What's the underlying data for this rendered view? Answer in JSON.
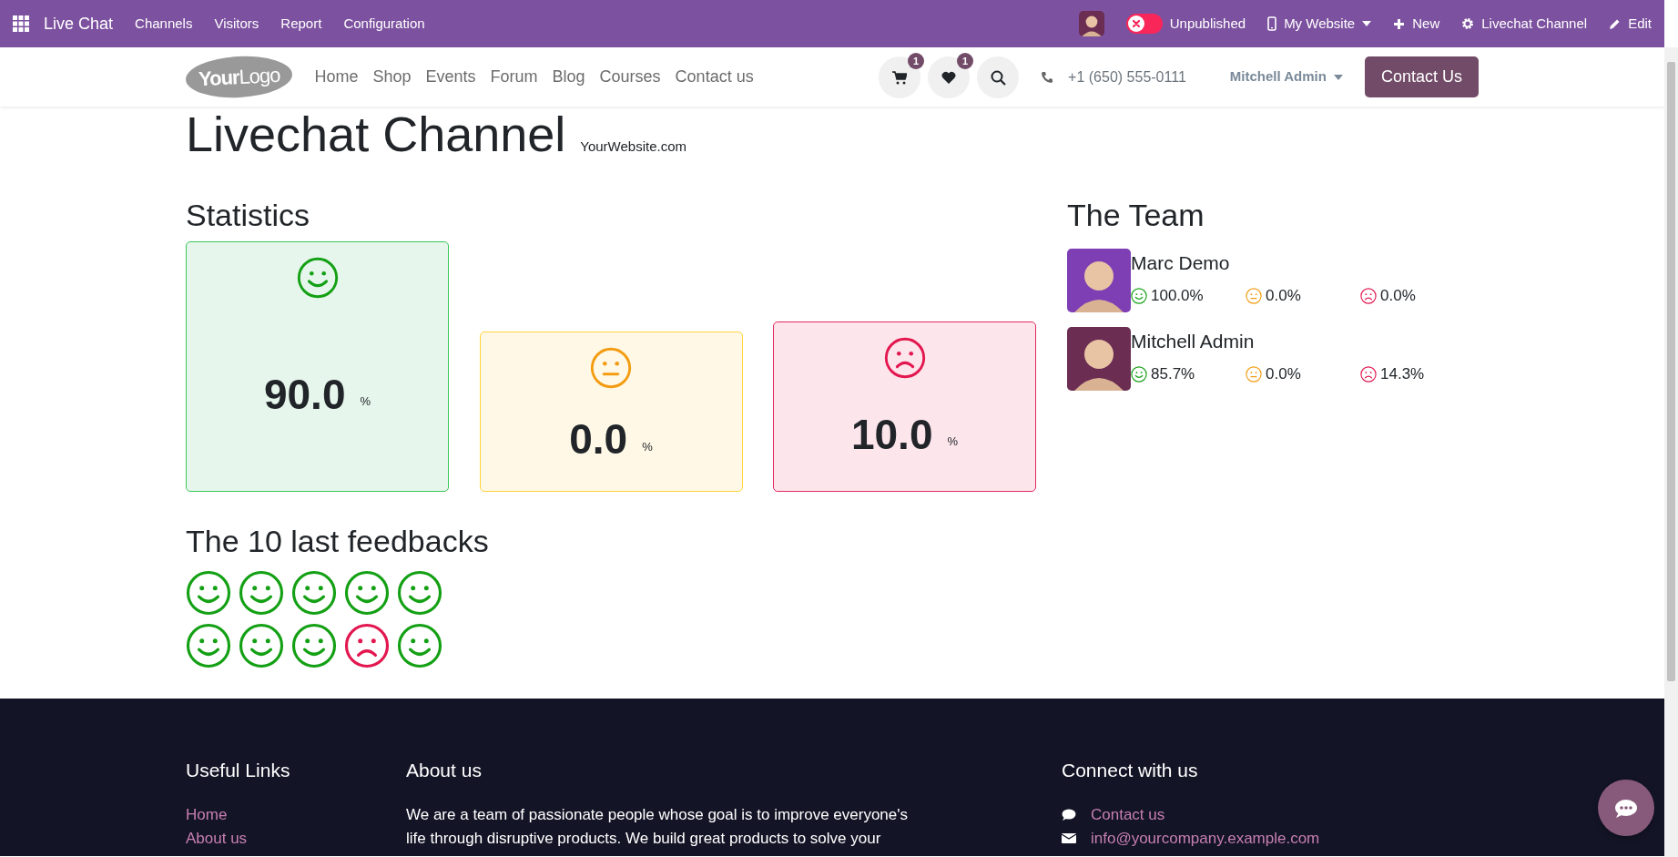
{
  "top_bar": {
    "app_title": "Live Chat",
    "menu": [
      "Channels",
      "Visitors",
      "Report",
      "Configuration"
    ],
    "publish": {
      "label": "Unpublished",
      "published": false
    },
    "items": [
      {
        "kind": "device",
        "label": "My Website"
      },
      {
        "kind": "new",
        "label": "New"
      },
      {
        "kind": "settings",
        "label": "Livechat Channel"
      },
      {
        "kind": "edit",
        "label": "Edit"
      }
    ]
  },
  "navbar": {
    "logo": "**Your**Logo",
    "links": [
      "Home",
      "Shop",
      "Events",
      "Forum",
      "Blog",
      "Courses",
      "Contact us"
    ],
    "cart_count": "1",
    "wishlist_count": "1",
    "phone": "+1 (650) 555-0111",
    "user": "Mitchell Admin",
    "cta": "Contact Us"
  },
  "page": {
    "title": "Livechat Channel",
    "subtitle": "YourWebsite.com"
  },
  "statistics": {
    "heading": "Statistics",
    "cards": [
      {
        "kind": "happy",
        "value": "90.0",
        "unit": "%"
      },
      {
        "kind": "neutral",
        "value": "0.0",
        "unit": "%"
      },
      {
        "kind": "sad",
        "value": "10.0",
        "unit": "%"
      }
    ]
  },
  "team": {
    "heading": "The Team",
    "members": [
      {
        "name": "Marc Demo",
        "happy": "100.0%",
        "neutral": "0.0%",
        "sad": "0.0%"
      },
      {
        "name": "Mitchell Admin",
        "happy": "85.7%",
        "neutral": "0.0%",
        "sad": "14.3%"
      }
    ]
  },
  "feedbacks": {
    "heading": "The 10 last feedbacks",
    "items": [
      {
        "kind": "happy"
      },
      {
        "kind": "happy"
      },
      {
        "kind": "happy"
      },
      {
        "kind": "happy"
      },
      {
        "kind": "happy"
      },
      {
        "kind": "happy"
      },
      {
        "kind": "happy"
      },
      {
        "kind": "happy"
      },
      {
        "kind": "sad"
      },
      {
        "kind": "happy"
      }
    ]
  },
  "footer": {
    "columns": [
      {
        "kind": "links",
        "heading": "Useful Links",
        "items": [
          "Home",
          "About us"
        ]
      },
      {
        "kind": "text",
        "heading": "About us",
        "text": "We are a team of passionate people whose goal is to improve everyone's life through disruptive products. We build great products to solve your"
      },
      {
        "kind": "contact",
        "heading": "Connect with us",
        "items": [
          {
            "kind": "chat",
            "label": "Contact us"
          },
          {
            "kind": "email",
            "label": "info@yourcompany.example.com"
          }
        ]
      }
    ]
  }
}
